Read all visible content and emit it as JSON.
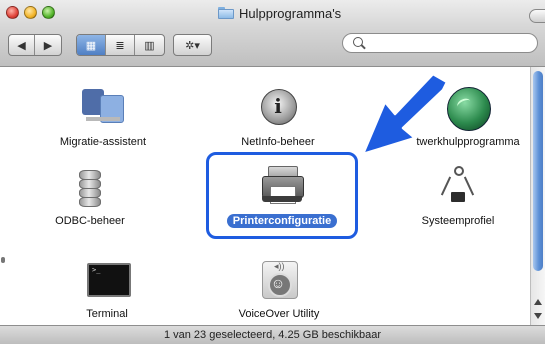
{
  "window": {
    "title": "Hulpprogramma's"
  },
  "toolbar": {
    "back_icon": "◀",
    "forward_icon": "▶",
    "view_icons": "▦",
    "view_list": "≣",
    "view_columns": "▥",
    "action_icon": "✲▾"
  },
  "search": {
    "placeholder": ""
  },
  "items": [
    {
      "label": "Migratie-assistent",
      "selected": false
    },
    {
      "label": "NetInfo-beheer",
      "selected": false
    },
    {
      "label": "twerkhulpprogramma",
      "selected": false
    },
    {
      "label": "ODBC-beheer",
      "selected": false
    },
    {
      "label": "Printerconfiguratie",
      "selected": true
    },
    {
      "label": "Systeemprofiel",
      "selected": false
    },
    {
      "label": "Terminal",
      "selected": false
    },
    {
      "label": "VoiceOver Utility",
      "selected": false
    }
  ],
  "terminal_prompt": ">_",
  "status": {
    "text": "1 van 23 geselecteerd, 4.25 GB beschikbaar"
  },
  "colors": {
    "highlight": "#1e5ce0",
    "selection": "#3a6fd0"
  }
}
